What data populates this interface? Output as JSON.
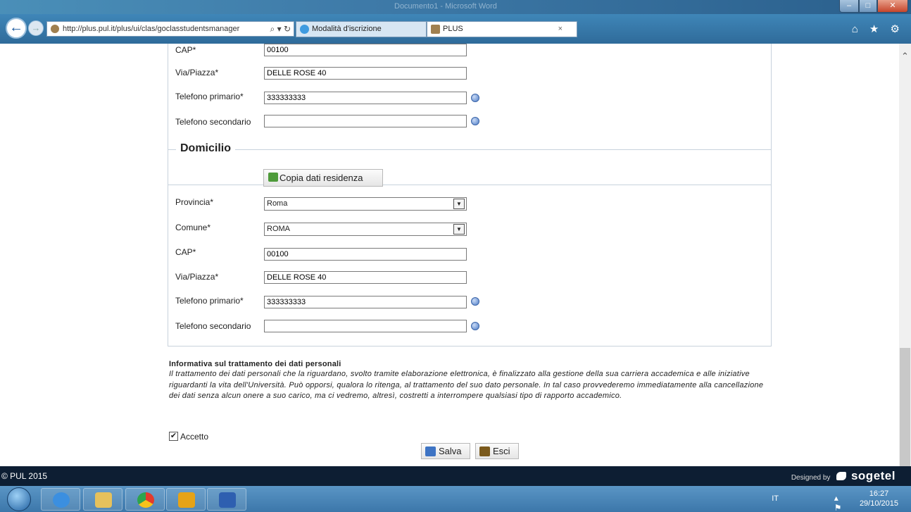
{
  "window": {
    "title": "Documento1 - Microsoft Word"
  },
  "browser": {
    "address": "http://plus.pul.it/plus/ui/clas/goclasstudentsmanager",
    "address_tools": "⌕ ▾ ↻",
    "tabs": [
      {
        "label": "Modalità d'iscrizione"
      },
      {
        "label": "PLUS",
        "close": "×"
      }
    ],
    "nav_icons": "⌂ ★ ⚙"
  },
  "residenza": {
    "cap_label": "CAP*",
    "cap_value": "00100",
    "via_label": "Via/Piazza*",
    "via_value": "DELLE ROSE 40",
    "tel1_label": "Telefono primario*",
    "tel1_value": "333333333",
    "tel2_label": "Telefono secondario",
    "tel2_value": ""
  },
  "domicilio": {
    "legend": "Domicilio",
    "copy_button": "Copia dati residenza",
    "provincia_label": "Provincia*",
    "provincia_value": "Roma",
    "comune_label": "Comune*",
    "comune_value": "ROMA",
    "cap_label": "CAP*",
    "cap_value": "00100",
    "via_label": "Via/Piazza*",
    "via_value": "DELLE ROSE 40",
    "tel1_label": "Telefono primario*",
    "tel1_value": "333333333",
    "tel2_label": "Telefono secondario",
    "tel2_value": ""
  },
  "privacy": {
    "title": "Informativa sul trattamento dei dati personali",
    "text": "Il trattamento dei dati personali che la riguardano, svolto tramite elaborazione elettronica, è finalizzato alla gestione della sua carriera accademica e alle iniziative riguardanti la vita dell'Università. Può opporsi, qualora lo ritenga, al trattamento del suo dato personale. In tal caso provvederemo immediatamente alla cancellazione dei dati senza alcun onere a suo carico, ma ci vedremo, altresì, costretti a interrompere qualsiasi tipo di rapporto accademico.",
    "accept_label": "Accetto",
    "accept_checked": true
  },
  "actions": {
    "save": "Salva",
    "exit": "Esci"
  },
  "footer": {
    "copyright": "© PUL 2015",
    "designed_by": "Designed by",
    "brand": "sogetel"
  },
  "taskbar": {
    "lang": "IT",
    "tray_icons": "▴ ⚑ ▭ ◀)",
    "time": "16:27",
    "date": "29/10/2015"
  }
}
